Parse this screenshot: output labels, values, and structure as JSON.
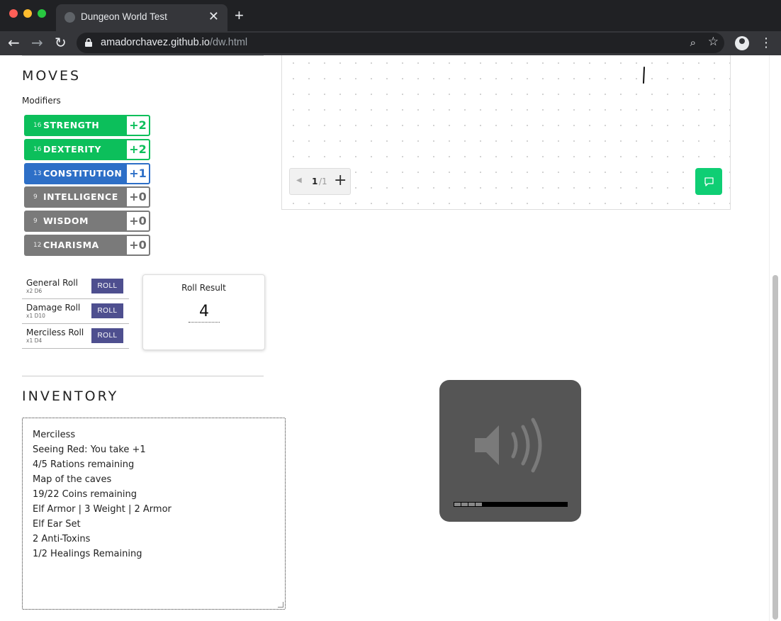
{
  "browser": {
    "tab_title": "Dungeon World Test",
    "tab_close": "✕",
    "new_tab": "+",
    "url_host": "amadorchavez.github.io",
    "url_path": "/dw.html"
  },
  "moves": {
    "title": "MOVES",
    "modifiers_label": "Modifiers",
    "stats": [
      {
        "score": "16",
        "name": "STRENGTH",
        "mod": "+2",
        "color": "green"
      },
      {
        "score": "16",
        "name": "DEXTERITY",
        "mod": "+2",
        "color": "green"
      },
      {
        "score": "13",
        "name": "CONSTITUTION",
        "mod": "+1",
        "color": "blue"
      },
      {
        "score": "9",
        "name": "INTELLIGENCE",
        "mod": "+0",
        "color": "gray"
      },
      {
        "score": "9",
        "name": "WISDOM",
        "mod": "+0",
        "color": "gray"
      },
      {
        "score": "12",
        "name": "CHARISMA",
        "mod": "+0",
        "color": "gray"
      }
    ],
    "rolls": [
      {
        "name": "General Roll",
        "dice": "x2 D6",
        "button": "ROLL"
      },
      {
        "name": "Damage Roll",
        "dice": "x1 D10",
        "button": "ROLL"
      },
      {
        "name": "Merciless Roll",
        "dice": "x1 D4",
        "button": "ROLL"
      }
    ],
    "roll_result": {
      "label": "Roll Result",
      "value": "4"
    }
  },
  "inventory": {
    "title": "INVENTORY",
    "items": [
      "Merciless",
      "Seeing Red: You take +1",
      "4/5 Rations remaining",
      "Map of the caves",
      "19/22 Coins remaining",
      "Elf Armor | 3 Weight | 2 Armor",
      "Elf Ear Set",
      "2 Anti-Toxins",
      "1/2 Healings Remaining"
    ]
  },
  "whiteboard": {
    "page": "1",
    "total": "/1",
    "add": "+"
  },
  "audio": {
    "progress": 0.25
  }
}
